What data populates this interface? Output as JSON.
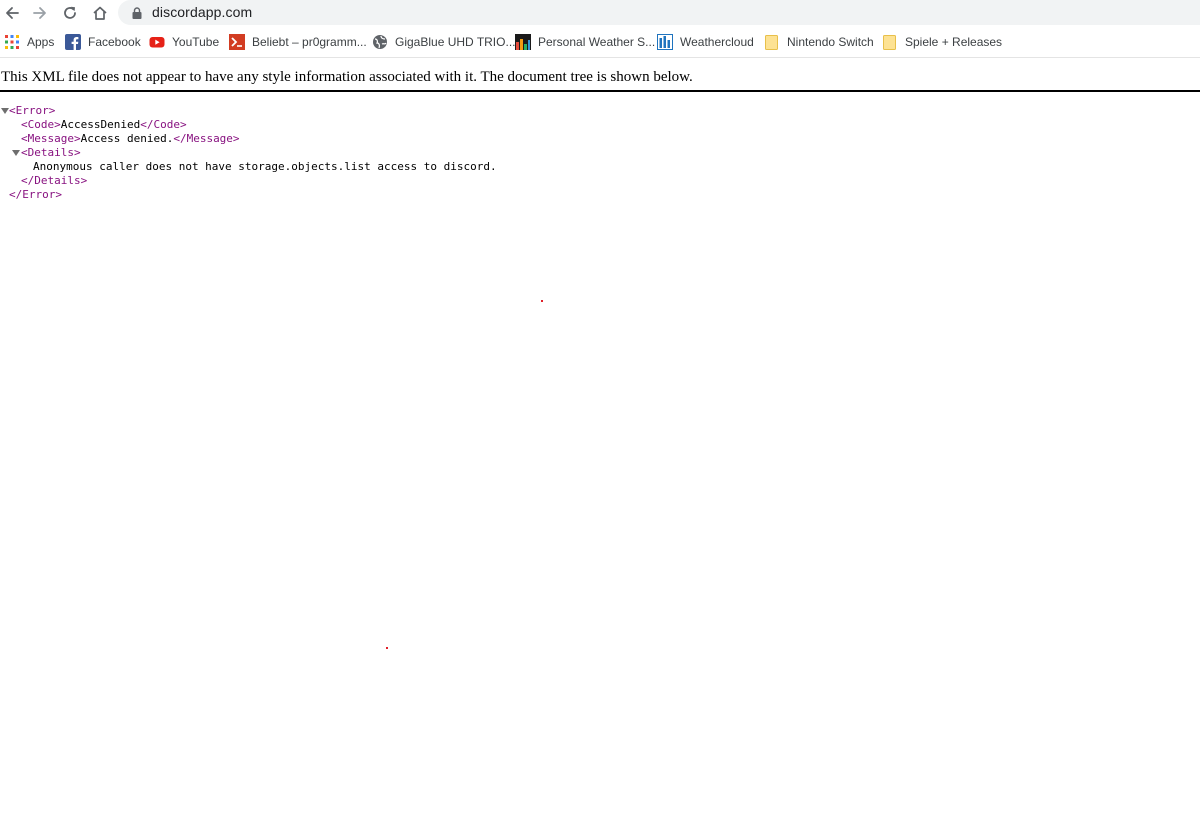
{
  "browser": {
    "url": "discordapp.com",
    "icons": {
      "back": "arrow-left-icon",
      "forward": "arrow-right-icon",
      "reload": "reload-icon",
      "home": "home-icon",
      "lock": "lock-icon"
    }
  },
  "bookmarks": [
    {
      "label": "Apps",
      "icon": "apps-grid-icon"
    },
    {
      "label": "Facebook",
      "icon": "facebook-icon",
      "color": "#3b5998"
    },
    {
      "label": "YouTube",
      "icon": "youtube-icon",
      "color": "#e62117"
    },
    {
      "label": "Beliebt – pr0gramm...",
      "icon": "pr0gramm-icon",
      "color": "#d23c22"
    },
    {
      "label": "GigaBlue UHD TRIO...",
      "icon": "globe-icon"
    },
    {
      "label": "Personal Weather S...",
      "icon": "wunderground-icon"
    },
    {
      "label": "Weathercloud",
      "icon": "weathercloud-icon",
      "color": "#1e73be"
    },
    {
      "label": "Nintendo Switch",
      "icon": "folder-icon",
      "color": "#f7d774"
    },
    {
      "label": "Spiele + Releases",
      "icon": "folder-icon",
      "color": "#f7d774"
    }
  ],
  "xml_viewer": {
    "notice": "This XML file does not appear to have any style information associated with it. The document tree is shown below.",
    "lines": {
      "error_open": "<Error>",
      "code_open": "<Code>",
      "code_value": "AccessDenied",
      "code_close": "</Code>",
      "message_open": "<Message>",
      "message_value": "Access denied.",
      "message_close": "</Message>",
      "details_open": "<Details>",
      "details_value": "Anonymous caller does not have storage.objects.list access to discord.",
      "details_close": "</Details>",
      "error_close": "</Error>"
    }
  },
  "colors": {
    "tag": "#881280",
    "omnibox_bg": "#f1f3f4",
    "text": "#202124"
  }
}
